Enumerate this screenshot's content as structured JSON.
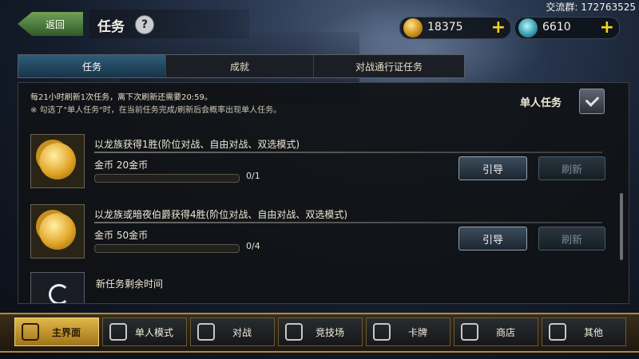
{
  "header": {
    "back_label": "返回",
    "title": "任务",
    "help_glyph": "?",
    "gold": "18375",
    "gems": "6610",
    "plus": "+",
    "watermark": "交流群: 172763525"
  },
  "tabs": [
    {
      "label": "任务",
      "active": true
    },
    {
      "label": "成就",
      "active": false
    },
    {
      "label": "对战通行证任务",
      "active": false
    }
  ],
  "notice": {
    "line1": "每21小时刷新1次任务，离下次刷新还需要20:59。",
    "line2": "※ 勾选了\"单人任务\"时，在当前任务完成/刷新后会概率出现单人任务。",
    "single_task_label": "单人任务",
    "single_task_checked": true
  },
  "quests": [
    {
      "name": "以龙族获得1胜(阶位对战、自由对战、双选模式)",
      "reward": "金币 20金币",
      "progress": "0/1",
      "progress_fraction": 0,
      "guide_label": "引导",
      "refresh_label": "刷新",
      "icon": "gold-coins-icon"
    },
    {
      "name": "以龙族或暗夜伯爵获得4胜(阶位对战、自由对战、双选模式)",
      "reward": "金币 50金币",
      "progress": "0/4",
      "progress_fraction": 0,
      "guide_label": "引导",
      "refresh_label": "刷新",
      "icon": "gold-coins-icon"
    }
  ],
  "new_task": {
    "label": "新任务剩余时间",
    "icon": "timer-icon"
  },
  "nav": [
    {
      "label": "主界面",
      "active": true,
      "icon": "home-icon"
    },
    {
      "label": "单人模式",
      "active": false,
      "icon": "single-mode-icon"
    },
    {
      "label": "对战",
      "active": false,
      "icon": "crossed-swords-icon"
    },
    {
      "label": "竞技场",
      "active": false,
      "icon": "arena-icon"
    },
    {
      "label": "卡牌",
      "active": false,
      "icon": "cards-icon"
    },
    {
      "label": "商店",
      "active": false,
      "icon": "shop-icon"
    },
    {
      "label": "其他",
      "active": false,
      "icon": "other-icon"
    }
  ],
  "colors": {
    "accent_gold": "#e0b74a",
    "tab_active": "#2f5d78",
    "plus_yellow": "#f2d520"
  }
}
